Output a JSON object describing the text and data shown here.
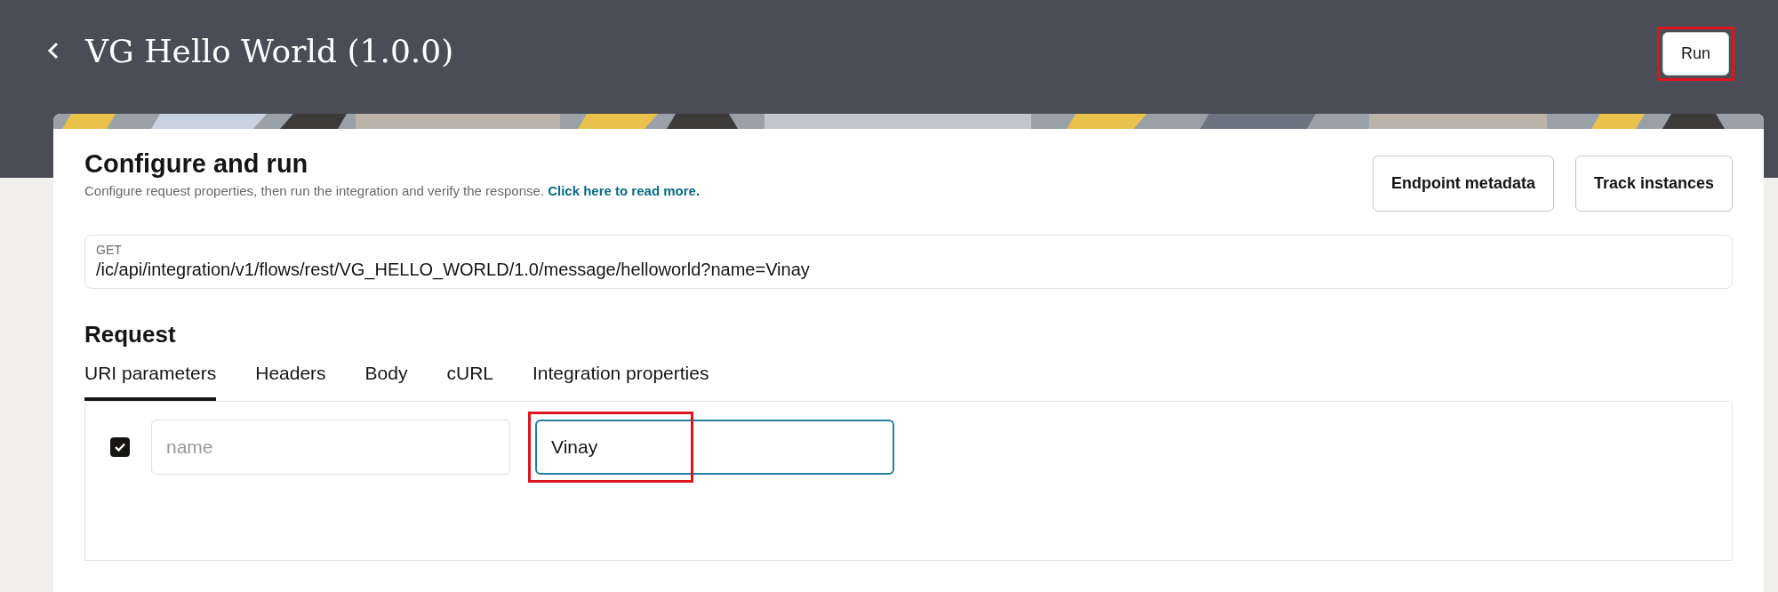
{
  "header": {
    "title": "VG Hello World (1.0.0)",
    "run_button": {
      "label": "Run",
      "highlighted": true
    }
  },
  "configure": {
    "title": "Configure and run",
    "description": "Configure request properties, then run the integration and verify the response.",
    "link": "Click here to read more.",
    "buttons": [
      "Endpoint metadata",
      "Track instances"
    ]
  },
  "endpoint": {
    "method": "GET",
    "url": "/ic/api/integration/v1/flows/rest/VG_HELLO_WORLD/1.0/message/helloworld?name=Vinay"
  },
  "request": {
    "title": "Request",
    "tabs": [
      {
        "label": "URI parameters",
        "selected": true
      },
      {
        "label": "Headers",
        "selected": false
      },
      {
        "label": "Body",
        "selected": false
      },
      {
        "label": "cURL",
        "selected": false
      },
      {
        "label": "Integration properties",
        "selected": false
      }
    ],
    "parameters": [
      {
        "checked": true,
        "placeholder": "name",
        "value": "Vinay",
        "highlighted": true
      }
    ]
  }
}
